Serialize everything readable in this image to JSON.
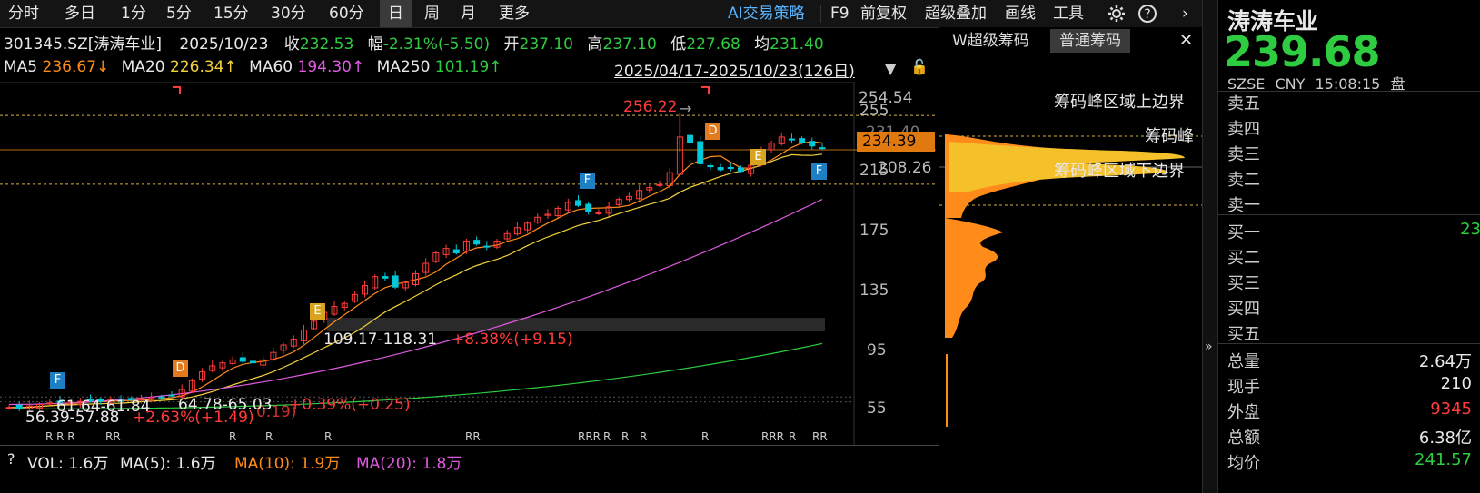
{
  "toolbar": {
    "periods": [
      "分时",
      "多日",
      "1分",
      "5分",
      "15分",
      "30分",
      "60分",
      "日",
      "周",
      "月",
      "更多"
    ],
    "selected_period": "日",
    "tools": [
      "AI交易策略",
      "F9",
      "前复权",
      "超级叠加",
      "画线",
      "工具"
    ],
    "gear_icon": "gear-icon",
    "help_icon": "help-icon",
    "next_icon": "chevron-right-icon"
  },
  "info_row": {
    "code": "301345.SZ[涛涛车业]",
    "date": "2025/10/23",
    "close_label": "收",
    "close": "232.53",
    "change_label": "幅",
    "change": "-2.31%(-5.50)",
    "open_label": "开",
    "open": "237.10",
    "high_label": "高",
    "high": "237.10",
    "low_label": "低",
    "low": "227.68",
    "avg_label": "均",
    "avg": "231.40"
  },
  "ma_row": {
    "ma5_label": "MA5",
    "ma5": "236.67↓",
    "ma20_label": "MA20",
    "ma20": "226.34↑",
    "ma60_label": "MA60",
    "ma60": "194.30↑",
    "ma250_label": "MA250",
    "ma250": "101.19↑",
    "range": "2025/04/17-2025/10/23(126日)"
  },
  "colors": {
    "up": "#ff3b3b",
    "down": "#00c8d8",
    "ma5": "#ff8c1a",
    "ma20": "#f2d13c",
    "ma60": "#e05ae0",
    "ma250": "#2ecc40",
    "accent": "#2ecc40"
  },
  "chart_data": {
    "type": "candlestick",
    "y_axis_ticks": [
      "255",
      "215",
      "175",
      "135",
      "95",
      "55"
    ],
    "ylim": [
      45,
      265
    ],
    "price_labels": {
      "top_dash": "254.54",
      "peak_mid": "231.40",
      "current": "234.39",
      "bottom_dash": "208.26"
    },
    "annotations": {
      "high_label": "256.22",
      "zone_text": "109.17-118.31",
      "zone_pct": "+8.38%(+9.15)",
      "low_range_1": "56.39-57.88",
      "low_pct_1": "+2.63%(+1.49)",
      "low_range_2": "61.64-61.84",
      "low_range_3": "64.78-65.03",
      "low_pct_3": "+0.39%(+0.25)",
      "low_pct_2": "0.19)"
    },
    "markers": [
      {
        "label": "F",
        "idx": 4
      },
      {
        "label": "D",
        "idx": 16
      },
      {
        "label": "E",
        "idx": 28
      },
      {
        "label": "F",
        "idx": 54
      },
      {
        "label": "D",
        "idx": 66
      },
      {
        "label": "E",
        "idx": 70
      },
      {
        "label": "F",
        "idx": 78
      }
    ],
    "r_labels": [
      "R R R",
      "RR",
      "R",
      "R",
      "R",
      "RR",
      "RRR",
      "R",
      "R",
      "R",
      "R",
      "RRR",
      "R",
      "RR"
    ],
    "closes": [
      58,
      57.5,
      59,
      60,
      61,
      61.5,
      61,
      62,
      62.5,
      62,
      63,
      62.5,
      63,
      64,
      64.5,
      65,
      66,
      70,
      76,
      82,
      86,
      88,
      90,
      89,
      88,
      90,
      95,
      100,
      104,
      110,
      116,
      122,
      126,
      128,
      134,
      140,
      146,
      145,
      139,
      142,
      148,
      155,
      162,
      165,
      162,
      170,
      168,
      166,
      170,
      175,
      179,
      182,
      186,
      188,
      192,
      196,
      194,
      190,
      189,
      193,
      198,
      200,
      204,
      206,
      208,
      216,
      240,
      236,
      222,
      220,
      218,
      219,
      217,
      221,
      230,
      236,
      240,
      238,
      236,
      234,
      232.53
    ]
  },
  "chips_panel": {
    "tab1": "W超级筹码",
    "tab2": "普通筹码",
    "close_icon": "close-icon",
    "label_top": "筹码峰区域上边界",
    "label_peak": "筹码峰",
    "label_bottom": "筹码峰区域下边界"
  },
  "volume_bar": {
    "help": "?",
    "vol_label": "VOL: 1.6万",
    "ma5_label": "MA(5): 1.6万",
    "ma10_label": "MA(10): 1.9万",
    "ma20_label": "MA(20): 1.8万"
  },
  "quote": {
    "name": "涛涛车业",
    "price": "239.68",
    "market": "SZSE",
    "currency": "CNY",
    "time": "15:08:15",
    "status": "盘",
    "sell_rows": [
      "卖五",
      "卖四",
      "卖三",
      "卖二",
      "卖一"
    ],
    "buy_rows": [
      "买一",
      "买二",
      "买三",
      "买四",
      "买五"
    ],
    "buy1_value": "23",
    "stats": [
      {
        "label": "总量",
        "value": "2.64万"
      },
      {
        "label": "现手",
        "value": "210"
      },
      {
        "label": "外盘",
        "value": "9345"
      },
      {
        "label": "总额",
        "value": "6.38亿"
      },
      {
        "label": "均价",
        "value": "241.57"
      }
    ]
  }
}
